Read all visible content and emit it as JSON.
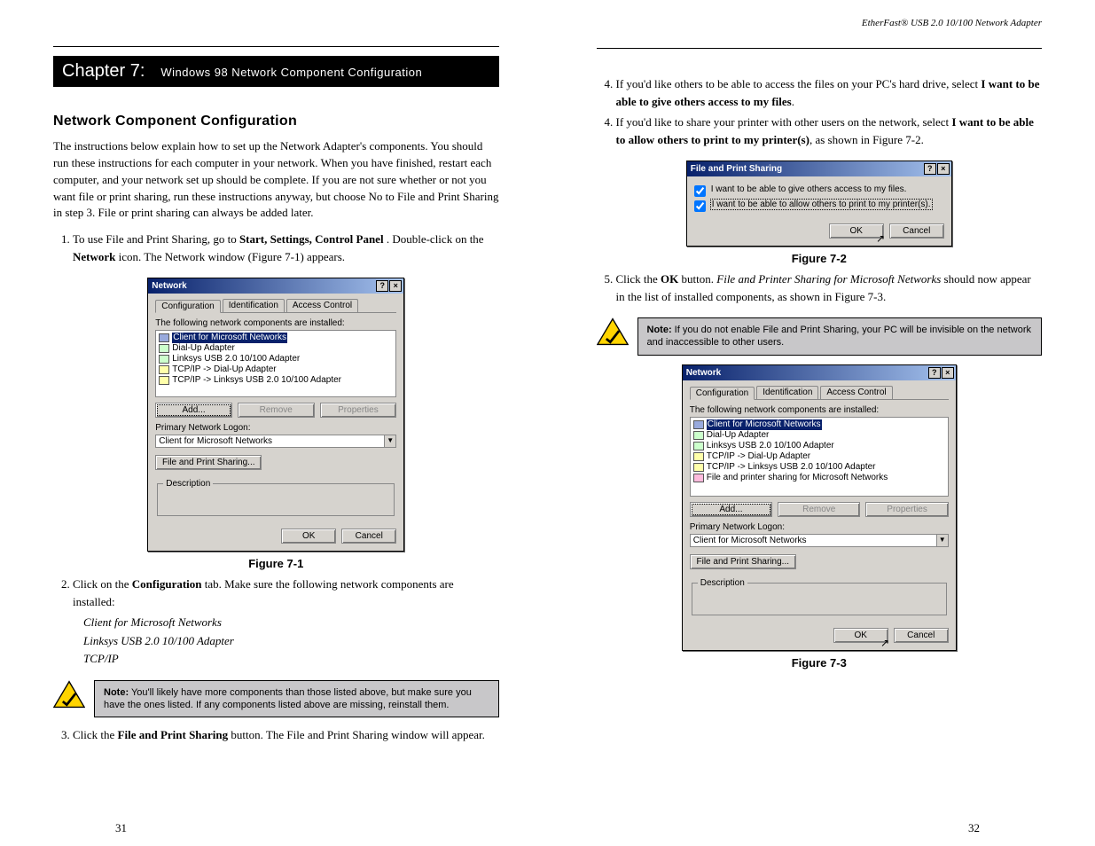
{
  "left": {
    "page_number": "31",
    "chapter": {
      "num": "Chapter 7:",
      "title": "Windows 98 Network Component Configuration"
    },
    "section": "Network Component Configuration",
    "para1a": "The instructions below explain how to set up the Network Adapter's components. You should run these instructions for each computer in your network. When you have finished, restart each computer, and your network set up should be complete. If you are not sure whether or not you want file or print sharing, run these instructions anyway, but choose No to File and Print Sharing in step 3. File or print sharing can always be added later.",
    "step1_intro": "To use File and Print Sharing, go to",
    "step1_menu": "Start, Settings, Control Panel",
    "step1_end": ". Double-click on the",
    "step1_network": "Network",
    "step1_after": "icon. The Network window (Figure 7-1) appears.",
    "fig71": {
      "caption": "Figure 7-1",
      "title": "Network",
      "tabs": [
        "Configuration",
        "Identification",
        "Access Control"
      ],
      "label_components": "The following network components are installed:",
      "items": [
        "Client for Microsoft Networks",
        "Dial-Up Adapter",
        "Linksys USB 2.0 10/100 Adapter",
        "TCP/IP -> Dial-Up Adapter",
        "TCP/IP -> Linksys USB 2.0 10/100 Adapter"
      ],
      "add": "Add...",
      "remove": "Remove",
      "properties": "Properties",
      "primary_label": "Primary Network Logon:",
      "primary_value": "Client for Microsoft Networks",
      "fps_btn": "File and Print Sharing...",
      "desc_legend": "Description",
      "ok": "OK",
      "cancel": "Cancel"
    },
    "step2_a": "Click on the",
    "step2_b": "Configuration",
    "step2_c": "tab. Make sure the following network components are installed:",
    "bullets": [
      "Client for Microsoft Networks",
      "Linksys USB 2.0 10/100 Adapter",
      "TCP/IP"
    ],
    "note": {
      "label": "Note:",
      "text": " You'll likely have more components than those listed above, but make sure you have the ones listed. If any components listed above are missing, reinstall them."
    },
    "step3_a": "Click the",
    "step3_b": "File and Print Sharing",
    "step3_c": "button. The File and Print Sharing window will appear."
  },
  "right": {
    "page_number": "32",
    "running_head": "EtherFast® USB 2.0 10/100 Network Adapter",
    "step4a_a": "If you'd like others to be able to access the files on your PC's hard drive, select",
    "step4a_b": "I want to be able to give others access to my files",
    "step4a_c": ".",
    "step4b_a": "If you'd like to share your printer with other users on the network, select",
    "step4b_b": "I want to be able to allow others to print to my printer(s)",
    "step4b_c": ", as shown in Figure 7-2.",
    "step5_a": "Click the",
    "step5_b": "OK",
    "step5_c": "button.",
    "step5_d": "File and Printer Sharing for Microsoft Networks",
    "step5_e": "should now appear in the list of installed components, as shown in Figure 7-3.",
    "fig72": {
      "caption": "Figure 7-2",
      "title": "File and Print Sharing",
      "opt1": "I want to be able to give others access to my files.",
      "opt2": "I want to be able to allow others to print to my printer(s).",
      "ok": "OK",
      "cancel": "Cancel"
    },
    "note": {
      "label": "Note:",
      "text": " If you do not enable File and Print Sharing, your PC will be invisible on the network and inaccessible to other users."
    },
    "fig73": {
      "caption": "Figure 7-3",
      "title": "Network",
      "tabs": [
        "Configuration",
        "Identification",
        "Access Control"
      ],
      "label_components": "The following network components are installed:",
      "items": [
        "Client for Microsoft Networks",
        "Dial-Up Adapter",
        "Linksys USB 2.0 10/100 Adapter",
        "TCP/IP -> Dial-Up Adapter",
        "TCP/IP -> Linksys USB 2.0 10/100 Adapter",
        "File and printer sharing for Microsoft Networks"
      ],
      "add": "Add...",
      "remove": "Remove",
      "properties": "Properties",
      "primary_label": "Primary Network Logon:",
      "primary_value": "Client for Microsoft Networks",
      "fps_btn": "File and Print Sharing...",
      "desc_legend": "Description",
      "ok": "OK",
      "cancel": "Cancel"
    }
  }
}
